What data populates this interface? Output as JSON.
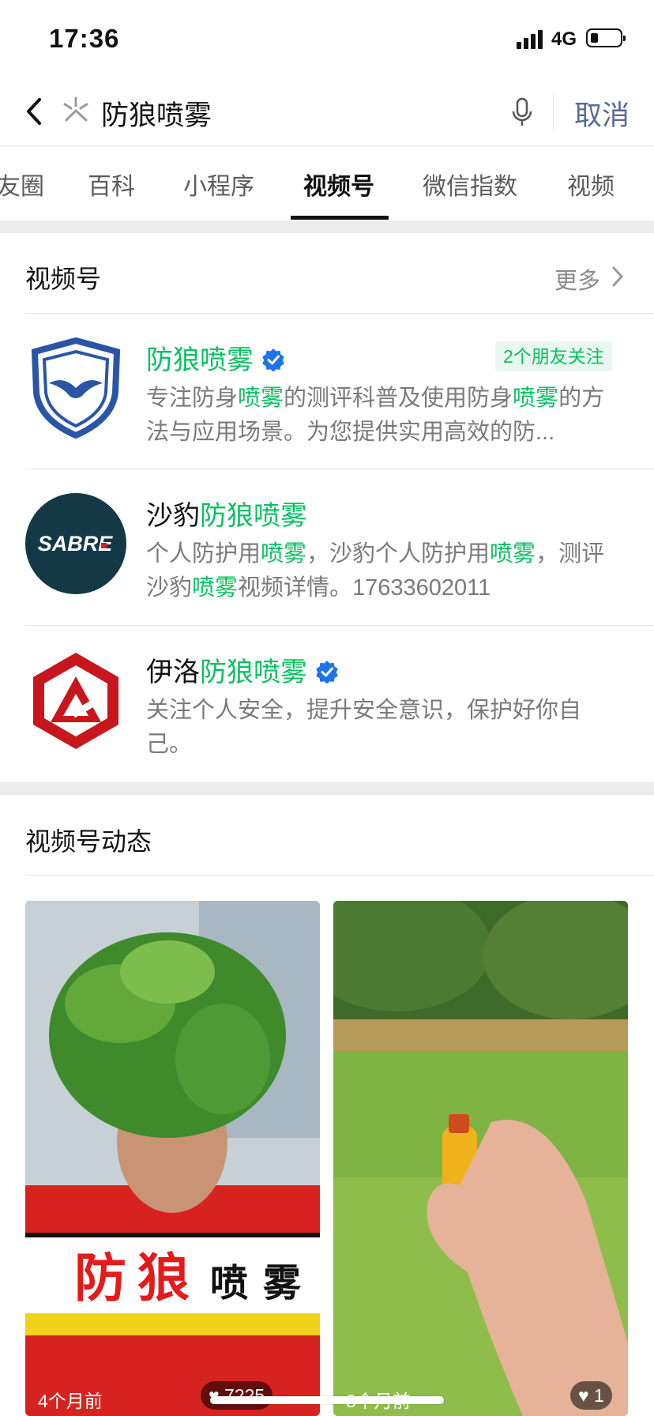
{
  "status_bar": {
    "time": "17:36",
    "network": "4G"
  },
  "search": {
    "query": "防狼喷雾",
    "cancel_label": "取消"
  },
  "tabs": [
    "友圈",
    "百科",
    "小程序",
    "视频号",
    "微信指数",
    "视频"
  ],
  "active_tab": "视频号",
  "channels_section": {
    "title": "视频号",
    "more_label": "更多",
    "accounts": [
      {
        "name_parts": [
          {
            "text": "防狼喷雾",
            "highlight": true
          }
        ],
        "verified": true,
        "friends_badge": "2个朋友关注",
        "desc_parts": [
          {
            "text": "专注防身",
            "highlight": false
          },
          {
            "text": "喷雾",
            "highlight": true
          },
          {
            "text": "的测评科普及使用防身",
            "highlight": false
          },
          {
            "text": "喷雾",
            "highlight": true
          },
          {
            "text": "的方法与应用场景。为您提供实用高效的防...",
            "highlight": false
          }
        ],
        "avatar_icon": "shield-wing-logo"
      },
      {
        "name_parts": [
          {
            "text": "沙豹",
            "highlight": false
          },
          {
            "text": "防狼喷雾",
            "highlight": true
          }
        ],
        "verified": false,
        "desc_parts": [
          {
            "text": "个人防护用",
            "highlight": false
          },
          {
            "text": "喷雾",
            "highlight": true
          },
          {
            "text": "，沙豹个人防护用",
            "highlight": false
          },
          {
            "text": "喷雾",
            "highlight": true
          },
          {
            "text": "，测评沙豹",
            "highlight": false
          },
          {
            "text": "喷雾",
            "highlight": true
          },
          {
            "text": "视频详情。17633602011",
            "highlight": false
          }
        ],
        "avatar_icon": "sabre-logo",
        "avatar_text": "SABRE"
      },
      {
        "name_parts": [
          {
            "text": "伊洛",
            "highlight": false
          },
          {
            "text": "防狼喷雾",
            "highlight": true
          }
        ],
        "verified": true,
        "desc_parts": [
          {
            "text": "关注个人安全，提升安全意识，保护好你自己。",
            "highlight": false
          }
        ],
        "avatar_icon": "red-hexagon-triangle-logo"
      }
    ]
  },
  "feed_section": {
    "title": "视频号动态",
    "videos": [
      {
        "banner_chars": [
          "防",
          "狼",
          "喷",
          "雾"
        ],
        "age": "4个月前",
        "likes": "7225"
      },
      {
        "age": "3个月前",
        "likes": "1"
      }
    ]
  },
  "colors": {
    "highlight_green": "#07c160",
    "link_blue": "#576b95",
    "badge_bg": "#e9f8ef",
    "sabre_bg": "#133846",
    "logo_red": "#c8161d"
  }
}
